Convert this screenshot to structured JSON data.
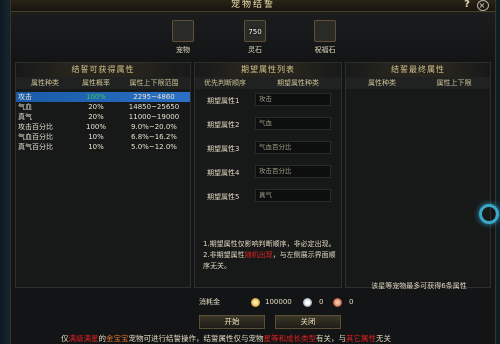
{
  "window": {
    "title": "宠物结誓",
    "help_label": "?",
    "close_label": "×"
  },
  "items": [
    {
      "name": "宠物",
      "icon": "pet-icon"
    },
    {
      "name": "灵石",
      "icon": "spirit-stone-icon",
      "count": "750"
    },
    {
      "name": "祝福石",
      "icon": "blessing-stone-icon"
    }
  ],
  "left_panel": {
    "title": "结誓可获得属性",
    "headers": [
      "属性种类",
      "属性概率",
      "属性上下限范围"
    ],
    "rows": [
      {
        "type": "攻击",
        "rate": "100%",
        "range": "2295~4860",
        "selected": true
      },
      {
        "type": "气血",
        "rate": "20%",
        "range": "14850~25650"
      },
      {
        "type": "真气",
        "rate": "20%",
        "range": "11000~19000"
      },
      {
        "type": "攻击百分比",
        "rate": "100%",
        "range": "9.0%~20.0%"
      },
      {
        "type": "气血百分比",
        "rate": "10%",
        "range": "6.8%~16.2%"
      },
      {
        "type": "真气百分比",
        "rate": "10%",
        "range": "5.0%~12.0%"
      }
    ]
  },
  "mid_panel": {
    "title": "期望属性列表",
    "headers": [
      "优先判断顺序",
      "期望属性种类"
    ],
    "rows": [
      {
        "label": "期望属性1",
        "value": "攻击"
      },
      {
        "label": "期望属性2",
        "value": "气血"
      },
      {
        "label": "期望属性3",
        "value": "气血百分比"
      },
      {
        "label": "期望属性4",
        "value": "攻击百分比"
      },
      {
        "label": "期望属性5",
        "value": "真气"
      }
    ],
    "note1": "1.期望属性仅影响判断顺序，非必定出现。",
    "note2_pre": "2.非期望属性",
    "note2_red": "随机出现",
    "note2_post": "，与左侧展示界面顺序无关。"
  },
  "right_panel": {
    "title": "结誓最终属性",
    "headers": [
      "属性种类",
      "属性上下限"
    ],
    "note": "该星等宠物最多可获得6条属性"
  },
  "cost": {
    "label": "消耗金",
    "gold": "100000",
    "silver": "0",
    "bronze": "0"
  },
  "buttons": {
    "start": "开始",
    "close": "关闭"
  },
  "footer": {
    "p1": "仅",
    "p2": "满级满星",
    "p3": "的",
    "p4": "金宝宝",
    "p5": "宠物可进行结誓操作，结誓属性仅与宠物",
    "p6": "星等和成长类型",
    "p7": "有关，与",
    "p8": "其它属性",
    "p9": "无关"
  }
}
